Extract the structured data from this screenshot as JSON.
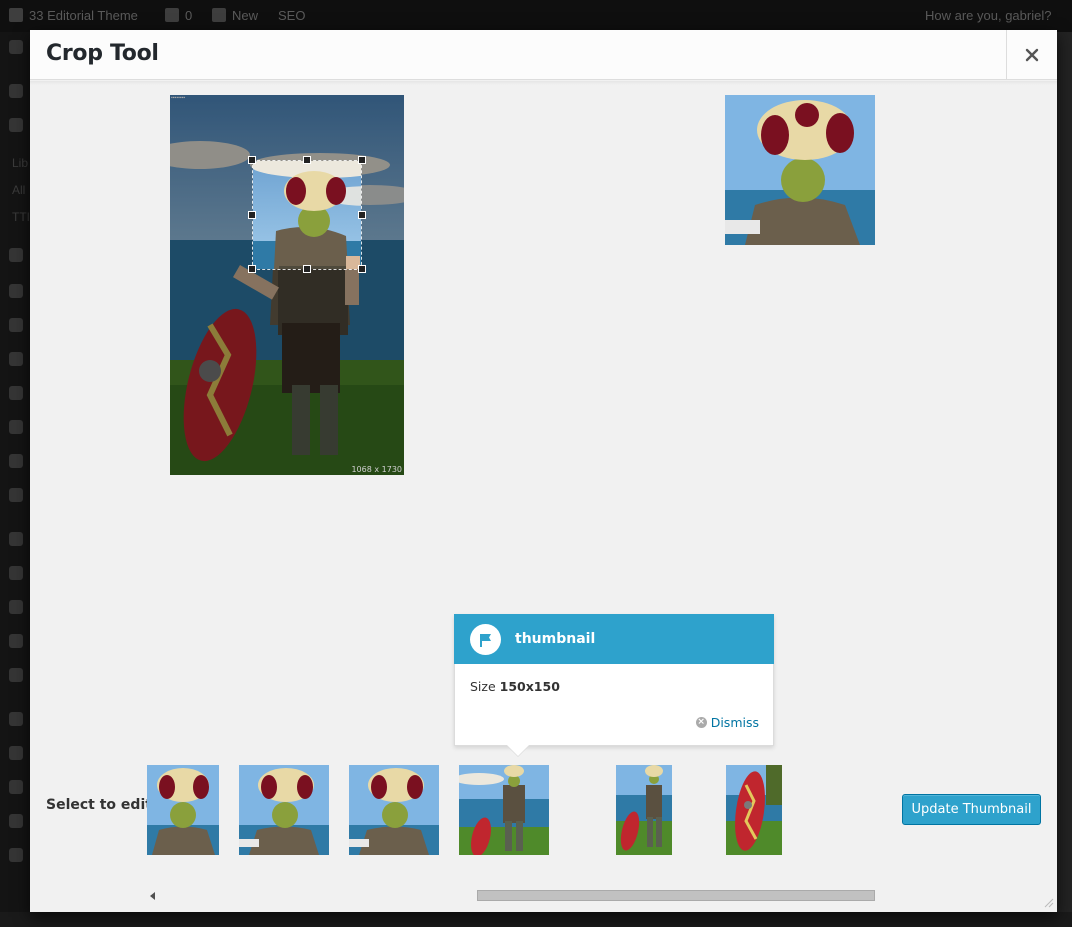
{
  "adminbar": {
    "site_name": "33 Editorial Theme",
    "comments": "0",
    "new_label": "New",
    "seo_label": "SEO",
    "greeting": "How are you, gabriel?"
  },
  "sidebar": {
    "fragments": [
      "Lib",
      "All",
      "TTI"
    ]
  },
  "modal": {
    "title": "Crop Tool",
    "close_icon": "close-icon"
  },
  "editor": {
    "image_dimensions": "1068 x 1730",
    "corner_label": "▪▪▪▪▪▪▪▪"
  },
  "tooltip": {
    "title": "thumbnail",
    "size_prefix": "Size",
    "size_value": "150x150",
    "dismiss_label": "Dismiss",
    "icon": "flag-icon",
    "accent": "#2ea2cc"
  },
  "bottom": {
    "select_label": "Select to edit",
    "update_button": "Update Thumbnail",
    "thumbnails": [
      {
        "name": "thumb-1"
      },
      {
        "name": "thumb-2"
      },
      {
        "name": "thumb-3"
      },
      {
        "name": "thumb-4"
      },
      {
        "name": "thumb-5"
      },
      {
        "name": "thumb-6"
      }
    ]
  },
  "colors": {
    "primary_button": "#2ea2cc",
    "link": "#0074a2",
    "modal_bg": "#f1f1f1"
  }
}
